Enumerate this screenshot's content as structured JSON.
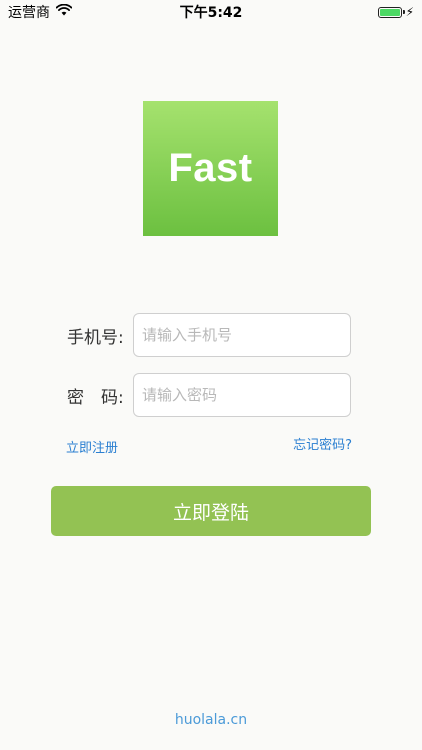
{
  "status_bar": {
    "carrier": "运营商",
    "time": "下午5:42"
  },
  "logo": {
    "text": "Fast"
  },
  "form": {
    "phone_label": "手机号:",
    "phone_placeholder": "请输入手机号",
    "password_label": "密　码:",
    "password_placeholder": "请输入密码"
  },
  "links": {
    "register": "立即注册",
    "forgot_password": "忘记密码?"
  },
  "login_button": "立即登陆",
  "footer": "huolala.cn",
  "colors": {
    "logo_top": "#a5e26e",
    "logo_bottom": "#6cc040",
    "button": "#93c253",
    "link": "#2a7fd1",
    "footer": "#4b9ad8",
    "battery": "#4cd964"
  }
}
